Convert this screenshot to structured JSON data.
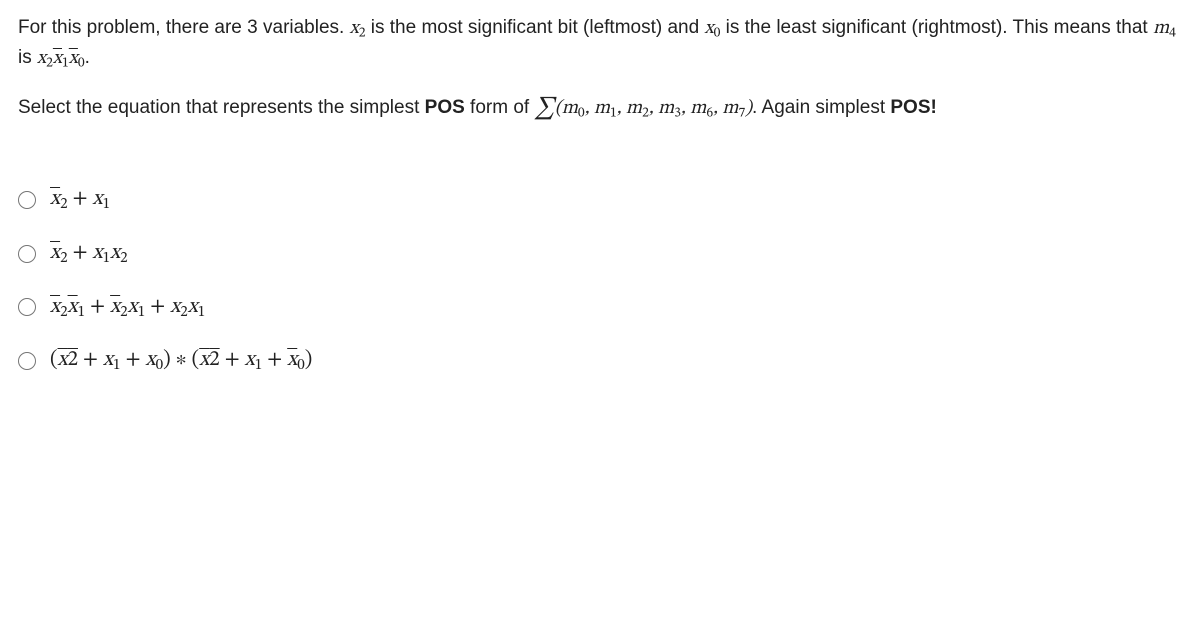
{
  "question": {
    "p1_a": "For this problem, there are 3 variables. ",
    "p1_b": " is the most significant bit (leftmost) and ",
    "p1_c": " is the least significant (rightmost). This means that ",
    "p1_d": " is ",
    "p1_e": ".",
    "p2_a": "Select the equation that represents the simplest ",
    "p2_pos1": "POS",
    "p2_b": " form of ",
    "p2_c": ". Again simplest ",
    "p2_pos2": "POS!",
    "var_x2": "x",
    "var_x2_sub": "2",
    "var_x0": "x",
    "var_x0_sub": "0",
    "var_m4": "m",
    "var_m4_sub": "4",
    "mlist": "m",
    "m_subs": [
      "0",
      "1",
      "2",
      "3",
      "6",
      "7"
    ]
  },
  "options": [
    {
      "id": "opt1",
      "html": "<span class='bar'><i>x</i></span><span class='sub'>2</span> + <i>x</i><span class='sub'>1</span>"
    },
    {
      "id": "opt2",
      "html": "<span class='bar'><i>x</i></span><span class='sub'>2</span> + <i>x</i><span class='sub'>1</span><i>x</i><span class='sub'>2</span>"
    },
    {
      "id": "opt3",
      "html": "<span class='bar'><i>x</i></span><span class='sub'>2</span><span class='bar'><i>x</i></span><span class='sub'>1</span> + <span class='bar'><i>x</i></span><span class='sub'>2</span><i>x</i><span class='sub'>1</span> + <i>x</i><span class='sub'>2</span><i>x</i><span class='sub'>1</span>"
    },
    {
      "id": "opt4",
      "html": "(<span class='bar'><i>x</i>2</span> + <i>x</i><span class='sub'>1</span> + <i>x</i><span class='sub'>0</span>) ∗ (<span class='bar'><i>x</i>2</span> + <i>x</i><span class='sub'>1</span> + <span class='bar'><i>x</i></span><span class='sub'>0</span>)"
    }
  ]
}
